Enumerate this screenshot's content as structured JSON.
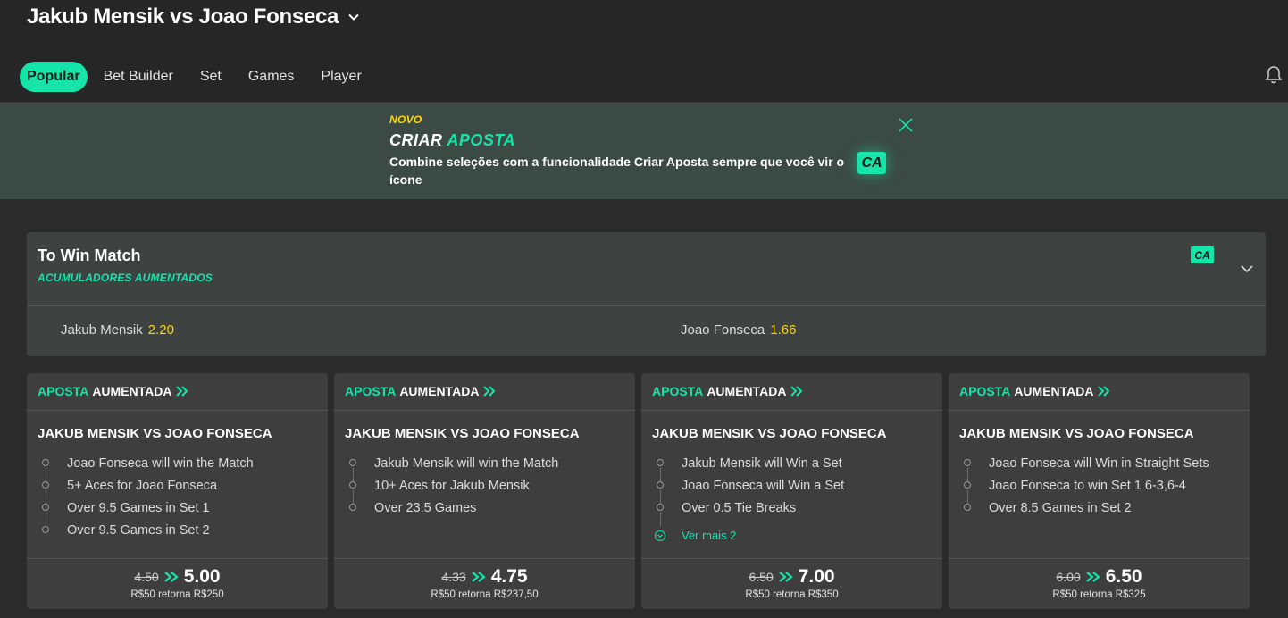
{
  "header": {
    "match_title": "Jakub Mensik vs Joao Fonseca",
    "tabs": [
      "Popular",
      "Bet Builder",
      "Set",
      "Games",
      "Player"
    ],
    "active_tab": "Popular"
  },
  "promo": {
    "tag": "NOVO",
    "title_white": "CRIAR",
    "title_green": "APOSTA",
    "description": "Combine seleções com a funcionalidade Criar Aposta sempre que você vir o ícone",
    "badge": "CA"
  },
  "market": {
    "title": "To Win Match",
    "subtitle": "ACUMULADORES AUMENTADOS",
    "badge": "CA",
    "selections": [
      {
        "name": "Jakub Mensik",
        "odds": "2.20"
      },
      {
        "name": "Joao Fonseca",
        "odds": "1.66"
      }
    ]
  },
  "boost_cards": [
    {
      "tag_green": "APOSTA",
      "tag_white": "AUMENTADA",
      "event": "JAKUB MENSIK VS JOAO FONSECA",
      "legs": [
        "Joao Fonseca will win the Match",
        "5+ Aces for Joao Fonseca",
        "Over 9.5 Games in Set 1",
        "Over 9.5 Games in Set 2"
      ],
      "more": "",
      "old_odds": "4.50",
      "new_odds": "5.00",
      "returns": "R$50 retorna R$250"
    },
    {
      "tag_green": "APOSTA",
      "tag_white": "AUMENTADA",
      "event": "JAKUB MENSIK VS JOAO FONSECA",
      "legs": [
        "Jakub Mensik will win the Match",
        "10+ Aces for Jakub Mensik",
        "Over 23.5 Games"
      ],
      "more": "",
      "old_odds": "4.33",
      "new_odds": "4.75",
      "returns": "R$50 retorna R$237,50"
    },
    {
      "tag_green": "APOSTA",
      "tag_white": "AUMENTADA",
      "event": "JAKUB MENSIK VS JOAO FONSECA",
      "legs": [
        "Jakub Mensik will Win a Set",
        "Joao Fonseca will Win a Set",
        "Over 0.5 Tie Breaks"
      ],
      "more": "Ver mais 2",
      "old_odds": "6.50",
      "new_odds": "7.00",
      "returns": "R$50 retorna R$350"
    },
    {
      "tag_green": "APOSTA",
      "tag_white": "AUMENTADA",
      "event": "JAKUB MENSIK VS JOAO FONSECA",
      "legs": [
        "Joao Fonseca will Win in Straight Sets",
        "Joao Fonseca to win Set 1 6-3,6-4",
        "Over 8.5 Games in Set 2"
      ],
      "more": "",
      "old_odds": "6.00",
      "new_odds": "6.50",
      "returns": "R$50 retorna R$325"
    }
  ],
  "colors": {
    "accent": "#15e5a8",
    "odds_yellow": "#ffd600",
    "background": "#2b2b2b",
    "promo_bg": "#3b4a44"
  }
}
